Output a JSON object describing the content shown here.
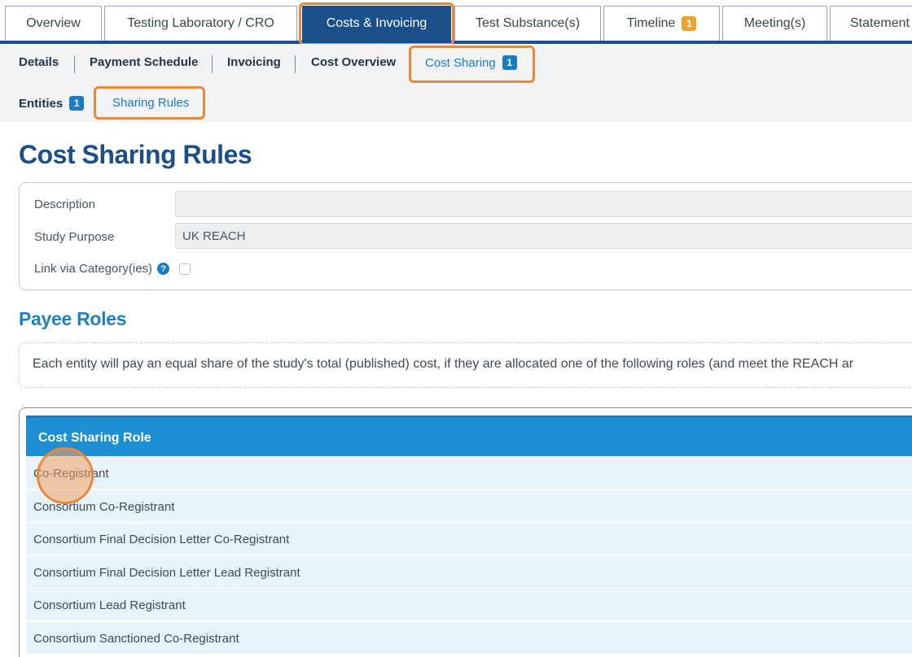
{
  "top_tabs": [
    {
      "label": "Overview"
    },
    {
      "label": "Testing Laboratory / CRO"
    },
    {
      "label": "Costs & Invoicing",
      "active": true
    },
    {
      "label": "Test Substance(s)"
    },
    {
      "label": "Timeline",
      "badge": "1"
    },
    {
      "label": "Meeting(s)"
    },
    {
      "label": "Statement"
    }
  ],
  "sub_nav": {
    "items": [
      {
        "label": "Details"
      },
      {
        "label": "Payment Schedule"
      },
      {
        "label": "Invoicing"
      },
      {
        "label": "Cost Overview"
      },
      {
        "label": "Cost Sharing",
        "badge": "1",
        "selected": true
      }
    ],
    "second_row": [
      {
        "label": "Entities",
        "badge": "1"
      },
      {
        "label": "Sharing Rules",
        "selected": true
      }
    ]
  },
  "page_title": "Cost Sharing Rules",
  "form": {
    "description_label": "Description",
    "description_value": "",
    "study_purpose_label": "Study Purpose",
    "study_purpose_value": "UK REACH",
    "link_category_label": "Link via Category(ies)",
    "link_category_checked": false
  },
  "payee_roles": {
    "heading": "Payee Roles",
    "note": "Each entity will pay an equal share of the study's total (published) cost, if they are allocated one of the following roles (and meet the REACH ar"
  },
  "table": {
    "header": "Cost Sharing Role",
    "rows": [
      "Co-Registrant",
      "Consortium Co-Registrant",
      "Consortium Final Decision Letter Co-Registrant",
      "Consortium Final Decision Letter Lead Registrant",
      "Consortium Lead Registrant",
      "Consortium Sanctioned Co-Registrant"
    ]
  },
  "colors": {
    "primary": "#1b4f8a",
    "accent": "#1a7dc4",
    "highlight": "#e8893a",
    "badge_orange": "#f0a32c"
  }
}
